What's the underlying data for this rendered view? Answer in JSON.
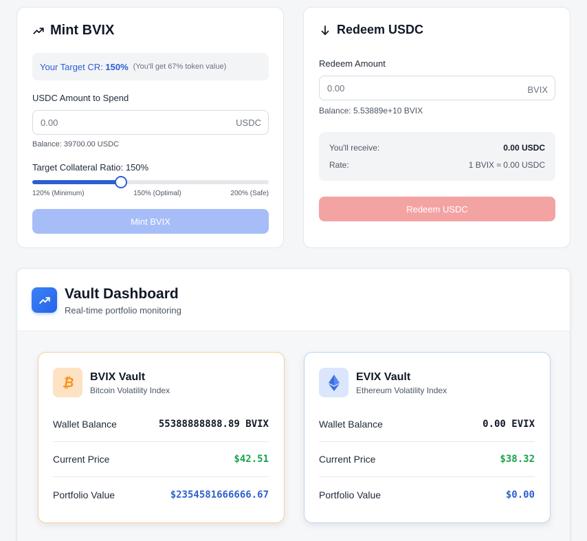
{
  "mint": {
    "title": "Mint BVIX",
    "target_label": "Your Target CR:",
    "target_value": "150%",
    "target_note": "(You'll get 67% token value)",
    "amount_label": "USDC Amount to Spend",
    "amount_placeholder": "0.00",
    "amount_unit": "USDC",
    "balance": "Balance: 39700.00 USDC",
    "ratio_label": "Target Collateral Ratio: 150%",
    "slider_value_percent": 150,
    "slider_min_percent": 120,
    "slider_max_percent": 200,
    "tick_min": "120% (Minimum)",
    "tick_mid": "150% (Optimal)",
    "tick_max": "200% (Safe)",
    "button": "Mint BVIX"
  },
  "redeem": {
    "title": "Redeem USDC",
    "amount_label": "Redeem Amount",
    "amount_placeholder": "0.00",
    "amount_unit": "BVIX",
    "balance": "Balance: 5.53889e+10 BVIX",
    "receive_label": "You'll receive:",
    "receive_value": "0.00 USDC",
    "rate_label": "Rate:",
    "rate_value": "1 BVIX ≈ 0.00 USDC",
    "button": "Redeem USDC"
  },
  "dashboard": {
    "title": "Vault Dashboard",
    "subtitle": "Real-time portfolio monitoring",
    "vaults": [
      {
        "name": "BVIX Vault",
        "subtitle": "Bitcoin Volatility Index",
        "icon": "bitcoin-icon",
        "rows": [
          {
            "label": "Wallet Balance",
            "value": "55388888888.89 BVIX"
          },
          {
            "label": "Current Price",
            "value": "$42.51"
          },
          {
            "label": "Portfolio Value",
            "value": "$2354581666666.67"
          }
        ]
      },
      {
        "name": "EVIX Vault",
        "subtitle": "Ethereum Volatility Index",
        "icon": "ethereum-icon",
        "rows": [
          {
            "label": "Wallet Balance",
            "value": "0.00 EVIX"
          },
          {
            "label": "Current Price",
            "value": "$38.32"
          },
          {
            "label": "Portfolio Value",
            "value": "$0.00"
          }
        ]
      }
    ]
  },
  "colors": {
    "accent_blue": "#2f5fd0",
    "price_green": "#16a34a",
    "mint_button_disabled": "#a6bdf7",
    "redeem_button_disabled": "#f4a3a3",
    "bitcoin_orange": "#f7931a",
    "ethereum_blue": "#3b6fe0"
  }
}
